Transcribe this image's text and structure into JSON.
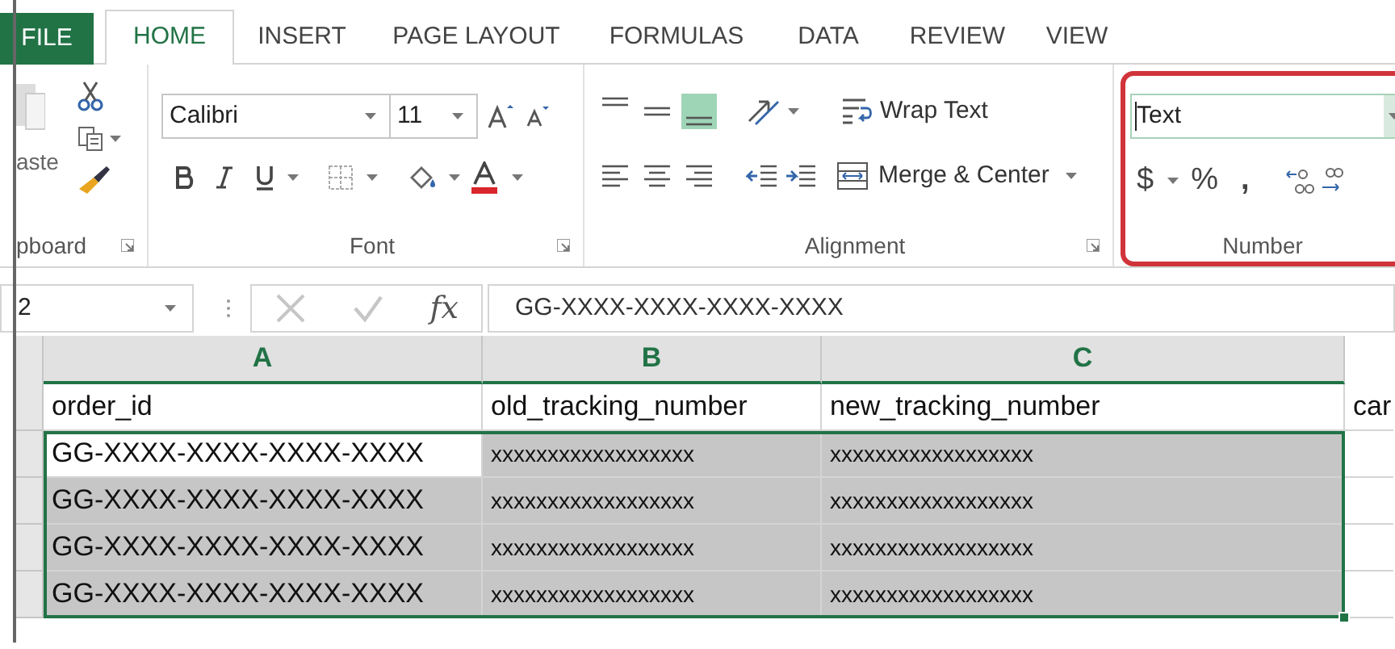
{
  "ribbon_tabs": [
    {
      "label": "FILE",
      "kind": "file",
      "selected": false
    },
    {
      "label": "HOME",
      "kind": "tab",
      "selected": true
    },
    {
      "label": "INSERT",
      "kind": "tab",
      "selected": false
    },
    {
      "label": "PAGE LAYOUT",
      "kind": "tab",
      "selected": false
    },
    {
      "label": "FORMULAS",
      "kind": "tab",
      "selected": false
    },
    {
      "label": "DATA",
      "kind": "tab",
      "selected": false
    },
    {
      "label": "REVIEW",
      "kind": "tab",
      "selected": false
    },
    {
      "label": "VIEW",
      "kind": "tab",
      "selected": false
    }
  ],
  "clipboard": {
    "paste_label": "aste",
    "group_label": "pboard"
  },
  "font": {
    "name": "Calibri",
    "size": "11",
    "group_label": "Font"
  },
  "alignment": {
    "wrap_text": "Wrap Text",
    "merge": "Merge & Center",
    "group_label": "Alignment"
  },
  "number": {
    "format": "Text",
    "group_label": "Number",
    "highlighted": true,
    "currency": "$",
    "percent": "%",
    "comma": ","
  },
  "name_box": "2",
  "function_label": "fx",
  "formula": "GG-XXXX-XXXX-XXXX-XXXX",
  "columns": [
    {
      "label": "A",
      "selected": true
    },
    {
      "label": "B",
      "selected": true
    },
    {
      "label": "C",
      "selected": true
    }
  ],
  "rows": [
    {
      "cells": [
        {
          "text": "order_id",
          "selected": false
        },
        {
          "text": "old_tracking_number",
          "selected": false
        },
        {
          "text": "new_tracking_number",
          "selected": false
        },
        {
          "text": "car",
          "selected": false
        }
      ]
    },
    {
      "cells": [
        {
          "text": "GG-XXXX-XXXX-XXXX-XXXX",
          "selected": false
        },
        {
          "text": "xxxxxxxxxxxxxxxxxx",
          "selected": true
        },
        {
          "text": "xxxxxxxxxxxxxxxxxx",
          "selected": true
        },
        {
          "selected": false
        }
      ]
    },
    {
      "cells": [
        {
          "text": "GG-XXXX-XXXX-XXXX-XXXX",
          "selected": true
        },
        {
          "text": "xxxxxxxxxxxxxxxxxx",
          "selected": true
        },
        {
          "text": "xxxxxxxxxxxxxxxxxx",
          "selected": true
        },
        {
          "selected": false
        }
      ]
    },
    {
      "cells": [
        {
          "text": "GG-XXXX-XXXX-XXXX-XXXX",
          "selected": true
        },
        {
          "text": "xxxxxxxxxxxxxxxxxx",
          "selected": true
        },
        {
          "text": "xxxxxxxxxxxxxxxxxx",
          "selected": true
        },
        {
          "selected": false
        }
      ]
    },
    {
      "cells": [
        {
          "text": "GG-XXXX-XXXX-XXXX-XXXX",
          "selected": true
        },
        {
          "text": "xxxxxxxxxxxxxxxxxx",
          "selected": true
        },
        {
          "text": "xxxxxxxxxxxxxxxxxx",
          "selected": true
        },
        {
          "selected": false
        }
      ]
    }
  ]
}
